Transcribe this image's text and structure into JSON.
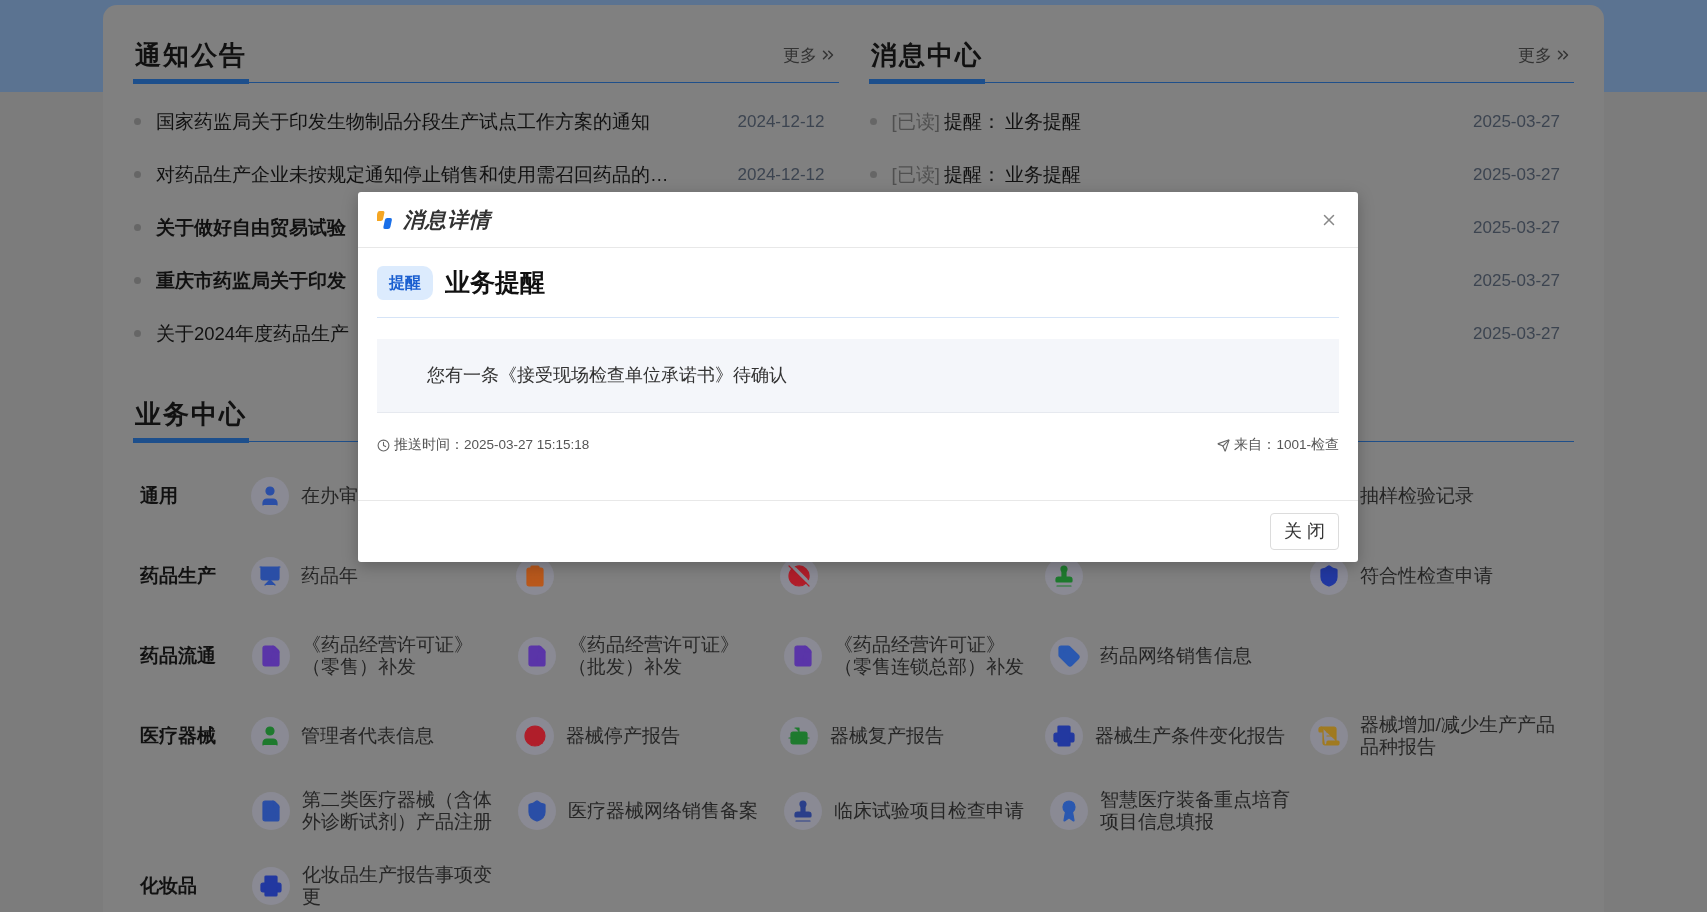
{
  "notices": {
    "title": "通知公告",
    "more": "更多",
    "items": [
      {
        "title": "国家药监局关于印发生物制品分段生产试点工作方案的通知",
        "bold": false,
        "date": "2024-12-12"
      },
      {
        "title": "对药品生产企业未按规定通知停止销售和使用需召回药品的…",
        "bold": false,
        "date": "2024-12-12"
      },
      {
        "title": "关于做好自由贸易试验",
        "bold": true
      },
      {
        "title": "重庆市药监局关于印发",
        "bold": true
      },
      {
        "title": "关于2024年度药品生产",
        "bold": false
      }
    ]
  },
  "messages": {
    "title": "消息中心",
    "more": "更多",
    "items": [
      {
        "read_tag": "[已读]",
        "category": "提醒：",
        "title": "业务提醒",
        "date": "2025-03-27"
      },
      {
        "read_tag": "[已读]",
        "category": "提醒：",
        "title": "业务提醒",
        "date": "2025-03-27"
      },
      {
        "date": "2025-03-27"
      },
      {
        "date": "2025-03-27"
      },
      {
        "date": "2025-03-27"
      }
    ]
  },
  "business": {
    "title": "业务中心",
    "rows": [
      {
        "label": "通用",
        "items": [
          {
            "kind": "full",
            "text": "在办审",
            "color": "#2a4ea6"
          },
          {
            "kind": "covered"
          },
          {
            "kind": "covered"
          },
          {
            "kind": "covered"
          },
          {
            "kind": "text",
            "text": "抽样检验记录"
          }
        ]
      },
      {
        "label": "药品生产",
        "items": [
          {
            "kind": "full",
            "text": "药品年",
            "color": "#2a4ea6"
          },
          {
            "kind": "icon",
            "color": "#b8581c"
          },
          {
            "kind": "icon",
            "color": "#b01e2a"
          },
          {
            "kind": "icon",
            "color": "#1e7a2e"
          },
          {
            "kind": "full",
            "text": "符合性检查申请",
            "color": "#2238a0"
          }
        ]
      },
      {
        "label": "药品流通",
        "items": [
          {
            "kind": "full",
            "text": "《药品经营许可证》（零售）补发",
            "color": "#5a35a8"
          },
          {
            "kind": "full",
            "text": "《药品经营许可证》（批发）补发",
            "color": "#5a35a8"
          },
          {
            "kind": "full",
            "text": "《药品经营许可证》（零售连锁总部）补发",
            "color": "#5a35a8"
          },
          {
            "kind": "full",
            "text": "药品网络销售信息",
            "color": "#2a58b0"
          }
        ]
      },
      {
        "label": "医疗器械",
        "items": [
          {
            "kind": "full",
            "text": "管理者代表信息",
            "color": "#1e7a2e"
          },
          {
            "kind": "full",
            "text": "器械停产报告",
            "color": "#b01e2a"
          },
          {
            "kind": "full",
            "text": "器械复产报告",
            "color": "#1e7a2e"
          },
          {
            "kind": "full",
            "text": "器械生产条件变化报告",
            "color": "#2238a0"
          },
          {
            "kind": "full",
            "text": "器械增加/减少生产产品品种报告",
            "color": "#a07a20"
          }
        ]
      },
      {
        "items": [
          {
            "kind": "full",
            "text": "第二类医疗器械（含体外诊断试剂）产品注册",
            "color": "#2a4ea6"
          },
          {
            "kind": "full",
            "text": "医疗器械网络销售备案",
            "color": "#2a4ea6"
          },
          {
            "kind": "full",
            "text": "临床试验项目检查申请",
            "color": "#2a3f8a"
          },
          {
            "kind": "full",
            "text": "智慧医疗装备重点培育项目信息填报",
            "color": "#2a58b0"
          }
        ]
      },
      {
        "label": "化妆品",
        "items": [
          {
            "kind": "full",
            "text": "化妆品生产报告事项变更",
            "color": "#2238a0"
          }
        ]
      }
    ]
  },
  "dialog": {
    "title": "消息详情",
    "tag": "提醒",
    "heading": "业务提醒",
    "body": "您有一条《接受现场检查单位承诺书》待确认",
    "time": "推送时间：2025-03-27 15:15:18",
    "source": "来自：1001-检查",
    "close_button": "关 闭"
  }
}
